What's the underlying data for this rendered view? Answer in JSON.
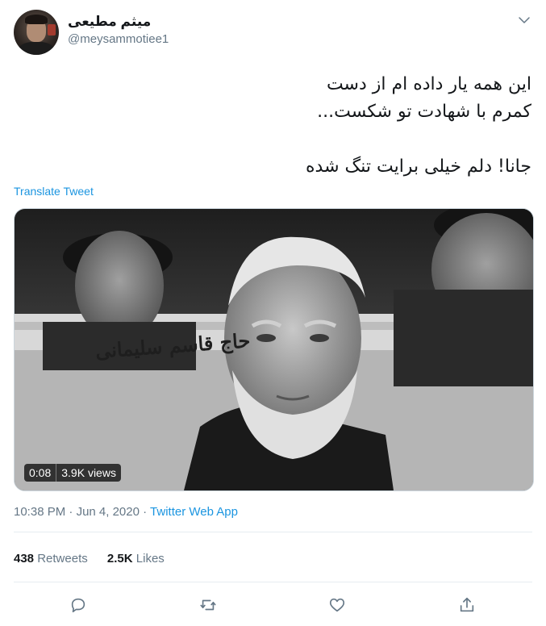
{
  "author": {
    "display_name": "میثم مطیعی",
    "handle": "@meysammotiee1"
  },
  "tweet": {
    "lines": [
      "این همه یار داده ام از دست",
      "کمرم با شهادت تو شکست..."
    ],
    "line_after_gap": "جانا! دلم خیلی برایت تنگ شده",
    "translate_label": "Translate Tweet"
  },
  "media": {
    "overlay_caption": "حاج قاسم سلیمانی",
    "duration": "0:08",
    "views": "3.9K views"
  },
  "meta": {
    "time": "10:38 PM",
    "separator": "·",
    "date": "Jun 4, 2020",
    "source": "Twitter Web App"
  },
  "stats": {
    "retweets_count": "438",
    "retweets_label": "Retweets",
    "likes_count": "2.5K",
    "likes_label": "Likes"
  },
  "icons": {
    "menu": "chevron-down-icon",
    "reply": "reply-icon",
    "retweet": "retweet-icon",
    "like": "heart-icon",
    "share": "share-icon"
  },
  "colors": {
    "link": "#1b95e0",
    "muted": "#657786",
    "text": "#14171a",
    "divider": "#e6ecf0"
  }
}
